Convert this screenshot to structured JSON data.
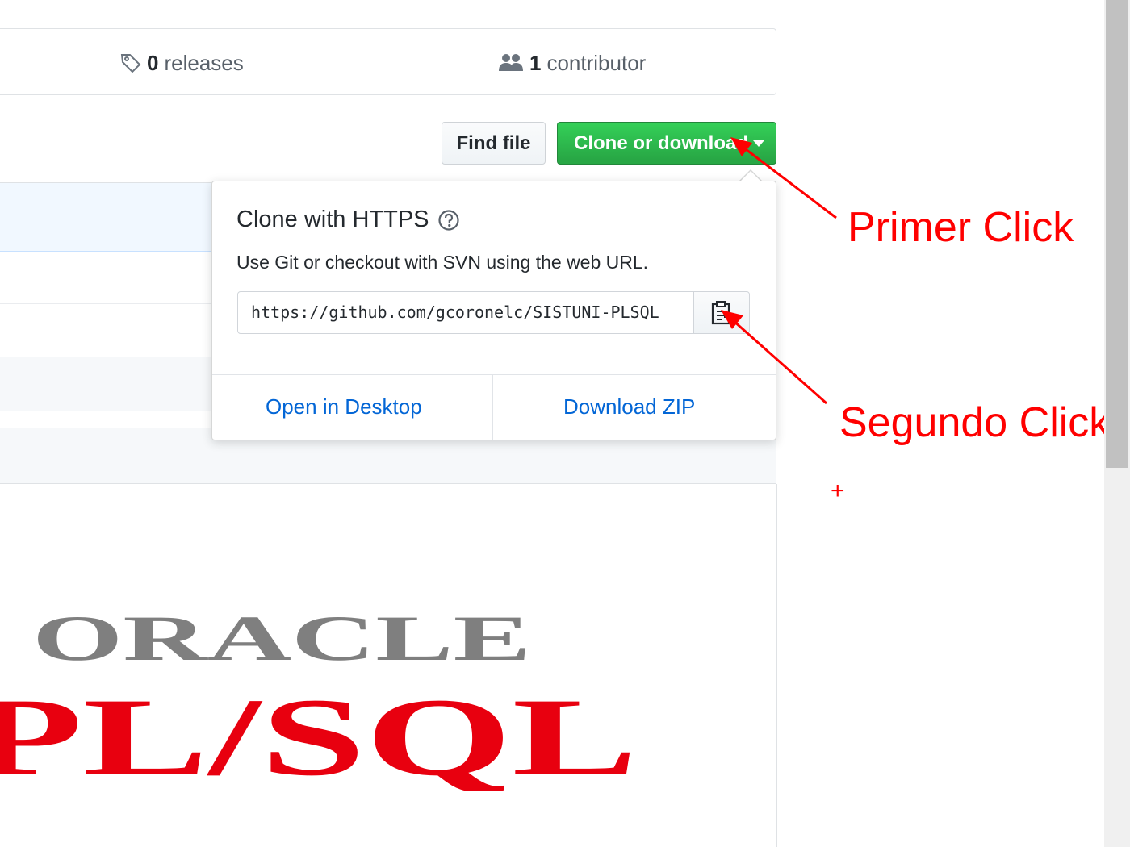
{
  "stats": {
    "releases_count": "0",
    "releases_label": "releases",
    "contributors_count": "1",
    "contributors_label": "contributor"
  },
  "toolbar": {
    "find_file_label": "Find file",
    "clone_label": "Clone or download"
  },
  "clone_dropdown": {
    "title": "Clone with HTTPS",
    "description": "Use Git or checkout with SVN using the web URL.",
    "url_value": "https://github.com/gcoronelc/SISTUNI-PLSQL",
    "open_desktop_label": "Open in Desktop",
    "download_zip_label": "Download ZIP"
  },
  "readme": {
    "logo_top_text": "ORACLE",
    "logo_bottom_text": "PL/SQL"
  },
  "annotations": {
    "first": "Primer Click",
    "second": "Segundo Click",
    "plus": "+"
  },
  "colors": {
    "clone_green": "#28a745",
    "link_blue": "#0366d6",
    "annotation_red": "#ff0000",
    "logo_gray": "#7f7f7f",
    "logo_red": "#e8000f"
  },
  "icons": {
    "releases": "tag-icon",
    "contributors": "people-icon",
    "help": "question-icon",
    "copy": "clipboard-icon"
  }
}
